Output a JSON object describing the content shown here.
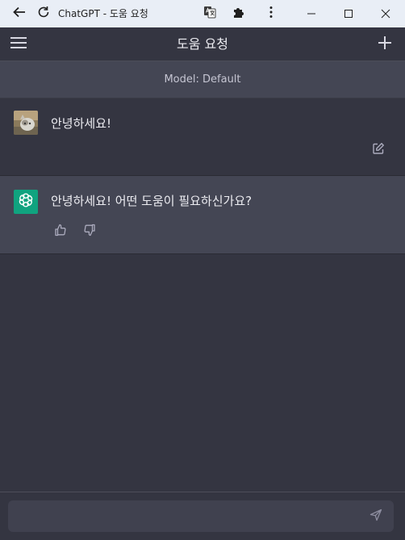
{
  "browser": {
    "title": "ChatGPT - 도움 요청",
    "icons": {
      "back": "arrow-left-icon",
      "reload": "reload-icon",
      "translate": "translate-icon",
      "extensions": "puzzle-icon",
      "menu": "kebab-menu-icon",
      "minimize": "minimize-icon",
      "maximize": "maximize-icon",
      "close": "close-icon"
    }
  },
  "header": {
    "title": "도움 요청",
    "menu_icon": "hamburger-icon",
    "new_chat_icon": "plus-icon"
  },
  "model_bar": {
    "label": "Model: Default"
  },
  "messages": [
    {
      "role": "user",
      "text": "안녕하세요!",
      "action_icon": "edit-icon"
    },
    {
      "role": "assistant",
      "text": "안녕하세요! 어떤 도움이 필요하신가요?",
      "action_icons": [
        "thumbs-up-icon",
        "thumbs-down-icon"
      ]
    }
  ],
  "composer": {
    "value": "",
    "placeholder": "",
    "send_icon": "send-icon"
  },
  "colors": {
    "background": "#343541",
    "assistant_row": "#444654",
    "text": "#ececf1",
    "openai_brand": "#10a37f",
    "titlebar": "#e9eef6"
  }
}
